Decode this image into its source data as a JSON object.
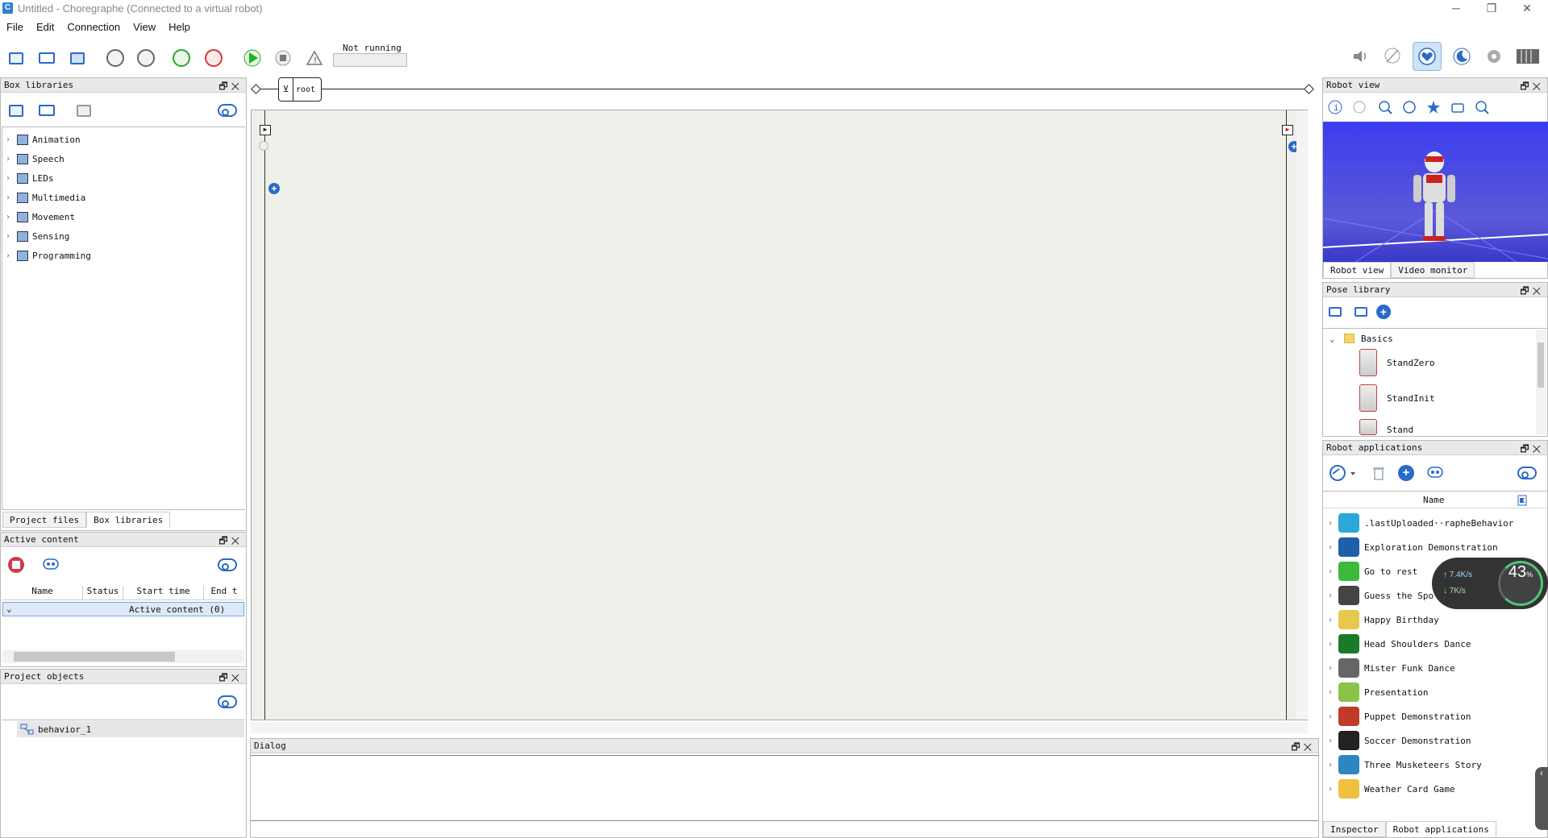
{
  "window": {
    "title": "Untitled - Choregraphe (Connected to a virtual robot)",
    "app_icon": "C"
  },
  "menu": [
    "File",
    "Edit",
    "Connection",
    "View",
    "Help"
  ],
  "toolbar": {
    "status": "Not running"
  },
  "breadcrumb": {
    "root": "root"
  },
  "box_libraries": {
    "title": "Box libraries",
    "items": [
      "Animation",
      "Speech",
      "LEDs",
      "Multimedia",
      "Movement",
      "Sensing",
      "Programming"
    ],
    "tabs": [
      "Project files",
      "Box libraries"
    ]
  },
  "active_content": {
    "title": "Active content",
    "columns": [
      "Name",
      "Status",
      "Start time",
      "End t"
    ],
    "group": "Active content (0)"
  },
  "project_objects": {
    "title": "Project objects",
    "items": [
      "behavior_1"
    ]
  },
  "dialog": {
    "title": "Dialog"
  },
  "robot_view": {
    "title": "Robot view",
    "tabs": [
      "Robot view",
      "Video monitor"
    ]
  },
  "pose_library": {
    "title": "Pose library",
    "folder": "Basics",
    "poses": [
      "StandZero",
      "StandInit",
      "Stand"
    ]
  },
  "robot_applications": {
    "title": "Robot applications",
    "column": "Name",
    "apps": [
      {
        "name": ".lastUploaded··rapheBehavior",
        "color": "#2ba7d8"
      },
      {
        "name": "Exploration Demonstration",
        "color": "#1e5fa8"
      },
      {
        "name": "Go to rest",
        "color": "#3cba3c"
      },
      {
        "name": "Guess the Spo",
        "color": "#444444"
      },
      {
        "name": "Happy Birthday",
        "color": "#e6c84a"
      },
      {
        "name": "Head Shoulders Dance",
        "color": "#1a7a2a"
      },
      {
        "name": "Mister Funk Dance",
        "color": "#666666"
      },
      {
        "name": "Presentation",
        "color": "#8bc34a"
      },
      {
        "name": "Puppet Demonstration",
        "color": "#c0392b"
      },
      {
        "name": "Soccer Demonstration",
        "color": "#222222"
      },
      {
        "name": "Three Musketeers Story",
        "color": "#2e86c1"
      },
      {
        "name": "Weather Card Game",
        "color": "#f0c040"
      }
    ],
    "tabs": [
      "Inspector",
      "Robot applications"
    ]
  },
  "network_overlay": {
    "up": "7.4K/s",
    "down": "7K/s",
    "percent": "43",
    "percent_unit": "%"
  }
}
